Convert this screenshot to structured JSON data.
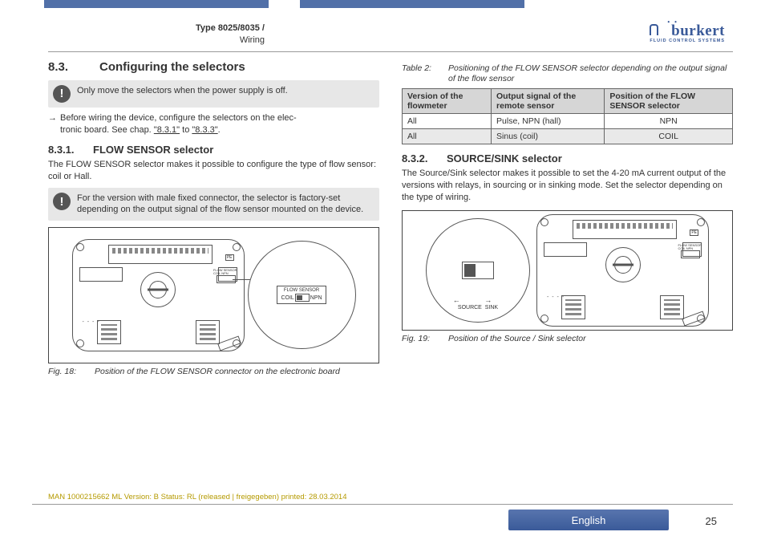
{
  "header": {
    "type_line": "Type 8025/8035 /",
    "subtitle": "Wiring",
    "brand": "burkert",
    "tagline": "FLUID CONTROL SYSTEMS"
  },
  "left": {
    "h2_num": "8.3.",
    "h2_title": "Configuring the selectors",
    "warn1": "Only move the selectors when the power supply is off.",
    "para1a": "Before wiring the device, configure the selectors on the elec-",
    "para1b": "tronic board. See chap. ",
    "link1": "\"8.3.1\"",
    "para1c": " to ",
    "link2": "\"8.3.3\"",
    "para1d": ".",
    "h3_num": "8.3.1.",
    "h3_title": "FLOW SENSOR selector",
    "para2": "The FLOW SENSOR selector makes it possible to configure the type of flow sensor: coil or Hall.",
    "warn2": "For the version with male fixed connector, the selector is factory-set depending on the output signal of the flow sensor mounted on the device.",
    "fig18_num": "Fig. 18:",
    "fig18_cap": "Position of the FLOW SENSOR connector on the electronic board",
    "fs_label": "FLOW SENSOR",
    "fs_coil": "COIL",
    "fs_npn": "NPN"
  },
  "right": {
    "tbl_caption_num": "Table 2:",
    "tbl_caption_txt": "Positioning of the FLOW SENSOR selector depending on the output signal of the flow sensor",
    "th1": "Version of the flowmeter",
    "th2": "Output signal of the remote sensor",
    "th3": "Position of the FLOW SENSOR selector",
    "r1c1": "All",
    "r1c2": "Pulse, NPN (hall)",
    "r1c3": "NPN",
    "r2c1": "All",
    "r2c2": "Sinus (coil)",
    "r2c3": "COIL",
    "h3_num": "8.3.2.",
    "h3_title": "SOURCE/SINK selector",
    "para1": "The Source/Sink selector makes it possible to set the 4-20 mA current output of the versions with relays, in sourcing or in sinking mode. Set the selector depending on the type of wiring.",
    "ss_source": "SOURCE",
    "ss_sink": "SINK",
    "fig19_num": "Fig. 19:",
    "fig19_cap": "Position of the Source / Sink selector"
  },
  "footer": {
    "meta": "MAN 1000215662 ML Version: B Status: RL (released | freigegeben) printed: 28.03.2014",
    "lang": "English",
    "page": "25"
  }
}
